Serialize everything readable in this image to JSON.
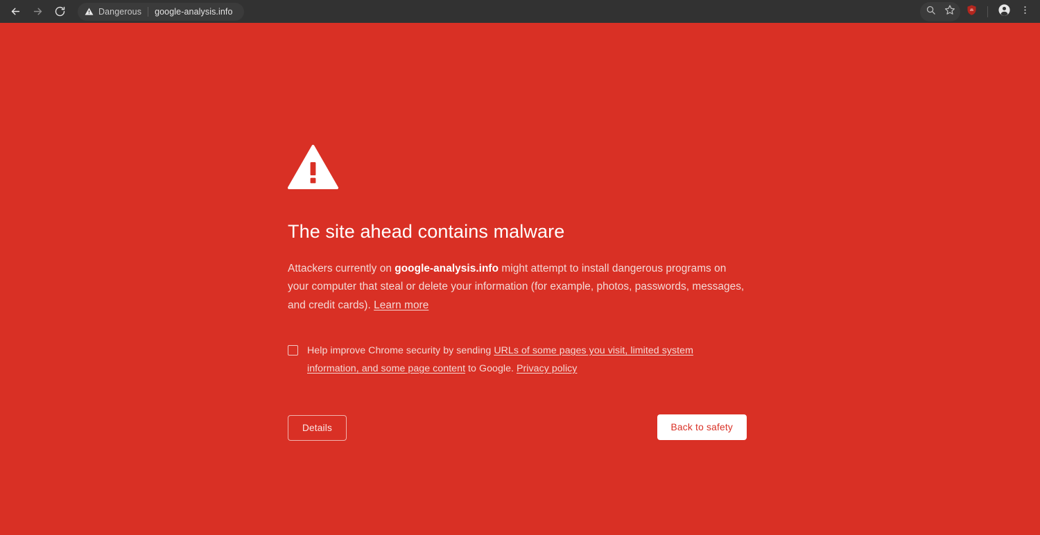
{
  "colors": {
    "interstitial_background": "#d93025",
    "toolbar_background": "#323232",
    "omnibox_background": "#3b3b3b",
    "primary_button_background": "#ffffff",
    "primary_button_text": "#d93025",
    "body_text": "#f4d9d6",
    "heading_text": "#ffffff",
    "extension_badge": "#b3261e"
  },
  "toolbar": {
    "back_icon": "arrow-left-icon",
    "forward_icon": "arrow-right-icon",
    "reload_icon": "reload-icon",
    "omnibox": {
      "security_icon": "warning-triangle-icon",
      "security_label": "Dangerous",
      "url": "google-analysis.info"
    },
    "right_icons": {
      "zoom_icon": "zoom-magnifier-icon",
      "bookmark_icon": "star-icon",
      "extension_icon": "shield-extension-icon",
      "profile_icon": "profile-avatar-icon",
      "menu_icon": "three-dot-menu-icon"
    }
  },
  "interstitial": {
    "icon": "warning-triangle-icon",
    "title": "The site ahead contains malware",
    "body": {
      "lead": "Attackers currently on ",
      "domain": "google-analysis.info",
      "rest": " might attempt to install dangerous programs on your computer that steal or delete your information (for example, photos, passwords, messages, and credit cards). ",
      "learn_more_label": "Learn more"
    },
    "optin": {
      "checked": false,
      "text_before": "Help improve Chrome security by sending ",
      "link_reporting": "URLs of some pages you visit, limited system information, and some page content",
      "text_middle": " to Google. ",
      "link_privacy": "Privacy policy"
    },
    "buttons": {
      "details_label": "Details",
      "back_to_safety_label": "Back to safety"
    }
  }
}
